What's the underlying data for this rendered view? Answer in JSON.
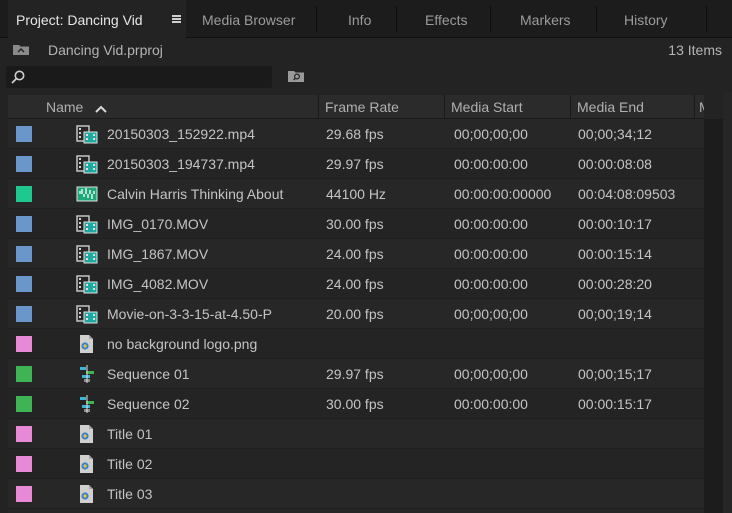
{
  "tabs": [
    {
      "label": "Project: Dancing Vid",
      "active": true
    },
    {
      "label": "Media Browser",
      "active": false
    },
    {
      "label": "Info",
      "active": false
    },
    {
      "label": "Effects",
      "active": false
    },
    {
      "label": "Markers",
      "active": false
    },
    {
      "label": "History",
      "active": false
    }
  ],
  "project": {
    "name": "Dancing Vid.prproj",
    "item_count": "13 Items"
  },
  "search": {
    "placeholder": ""
  },
  "columns": {
    "name": "Name",
    "frame_rate": "Frame Rate",
    "media_start": "Media Start",
    "media_end": "Media End",
    "media_duration": "Me"
  },
  "label_colors": {
    "iris": "#6b96c9",
    "caribbean": "#1fc88f",
    "magenta": "#e889d8",
    "forest": "#3fb455"
  },
  "rows": [
    {
      "label": "iris",
      "type_icon": "video-clip-icon",
      "name": "20150303_152922.mp4",
      "frame_rate": "29.68 fps",
      "media_start": "00;00;00;00",
      "media_end": "00;00;34;12"
    },
    {
      "label": "iris",
      "type_icon": "video-clip-icon",
      "name": "20150303_194737.mp4",
      "frame_rate": "29.97 fps",
      "media_start": "00:00:00:00",
      "media_end": "00:00:08:08"
    },
    {
      "label": "caribbean",
      "type_icon": "audio-clip-icon",
      "name": "Calvin Harris Thinking About",
      "frame_rate": "44100 Hz",
      "media_start": "00:00:00:00000",
      "media_end": "00:04:08:09503"
    },
    {
      "label": "iris",
      "type_icon": "video-clip-icon",
      "name": "IMG_0170.MOV",
      "frame_rate": "30.00 fps",
      "media_start": "00:00:00:00",
      "media_end": "00:00:10:17"
    },
    {
      "label": "iris",
      "type_icon": "video-clip-icon",
      "name": "IMG_1867.MOV",
      "frame_rate": "24.00 fps",
      "media_start": "00:00:00:00",
      "media_end": "00:00:15:14"
    },
    {
      "label": "iris",
      "type_icon": "video-clip-icon",
      "name": "IMG_4082.MOV",
      "frame_rate": "24.00 fps",
      "media_start": "00:00:00:00",
      "media_end": "00:00:28:20"
    },
    {
      "label": "iris",
      "type_icon": "video-clip-icon",
      "name": "Movie-on-3-3-15-at-4.50-P",
      "frame_rate": "20.00 fps",
      "media_start": "00;00;00;00",
      "media_end": "00;00;19;14"
    },
    {
      "label": "magenta",
      "type_icon": "still-image-icon",
      "name": "no background logo.png",
      "frame_rate": "",
      "media_start": "",
      "media_end": ""
    },
    {
      "label": "forest",
      "type_icon": "sequence-icon",
      "name": "Sequence 01",
      "frame_rate": "29.97 fps",
      "media_start": "00;00;00;00",
      "media_end": "00;00;15;17"
    },
    {
      "label": "forest",
      "type_icon": "sequence-icon",
      "name": "Sequence 02",
      "frame_rate": "30.00 fps",
      "media_start": "00:00:00:00",
      "media_end": "00:00:15:17"
    },
    {
      "label": "magenta",
      "type_icon": "title-icon",
      "name": "Title 01",
      "frame_rate": "",
      "media_start": "",
      "media_end": ""
    },
    {
      "label": "magenta",
      "type_icon": "title-icon",
      "name": "Title 02",
      "frame_rate": "",
      "media_start": "",
      "media_end": ""
    },
    {
      "label": "magenta",
      "type_icon": "title-icon",
      "name": "Title 03",
      "frame_rate": "",
      "media_start": "",
      "media_end": ""
    }
  ]
}
